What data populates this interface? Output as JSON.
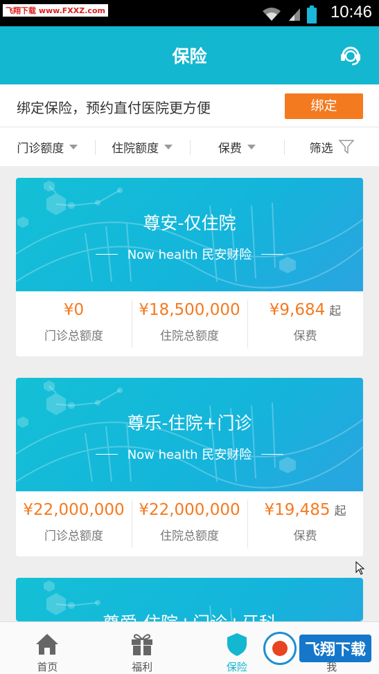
{
  "status_bar": {
    "watermark": "飞翔下载 www.FXXZ.com",
    "time": "10:46"
  },
  "header": {
    "title": "保险",
    "support_icon": "headset-icon"
  },
  "bind_bar": {
    "text": "绑定保险，预约直付医院更方便",
    "button_label": "绑定"
  },
  "filters": [
    {
      "label": "门诊额度",
      "icon": "caret-down-icon"
    },
    {
      "label": "住院额度",
      "icon": "caret-down-icon"
    },
    {
      "label": "保费",
      "icon": "caret-down-icon"
    },
    {
      "label": "筛选",
      "icon": "funnel-icon"
    }
  ],
  "products": [
    {
      "name": "尊安-仅住院",
      "subtitle": "Now health 民安财险",
      "stats": [
        {
          "value": "¥0",
          "label": "门诊总额度",
          "suffix": ""
        },
        {
          "value": "¥18,500,000",
          "label": "住院总额度",
          "suffix": ""
        },
        {
          "value": "¥9,684",
          "label": "保费",
          "suffix": "起"
        }
      ]
    },
    {
      "name": "尊乐-住院+门诊",
      "subtitle": "Now health 民安财险",
      "stats": [
        {
          "value": "¥22,000,000",
          "label": "门诊总额度",
          "suffix": ""
        },
        {
          "value": "¥22,000,000",
          "label": "住院总额度",
          "suffix": ""
        },
        {
          "value": "¥19,485",
          "label": "保费",
          "suffix": "起"
        }
      ]
    },
    {
      "name": "尊爱-住院+门诊+牙科"
    }
  ],
  "tabs": [
    {
      "label": "首页",
      "icon": "home-icon"
    },
    {
      "label": "福利",
      "icon": "gift-icon"
    },
    {
      "label": "保险",
      "icon": "shield-icon",
      "active": true
    },
    {
      "label": "我",
      "icon": "user-icon"
    }
  ],
  "bottom_watermark": "飞翔下载",
  "colors": {
    "primary": "#13b7cf",
    "accent": "#f47a20"
  }
}
